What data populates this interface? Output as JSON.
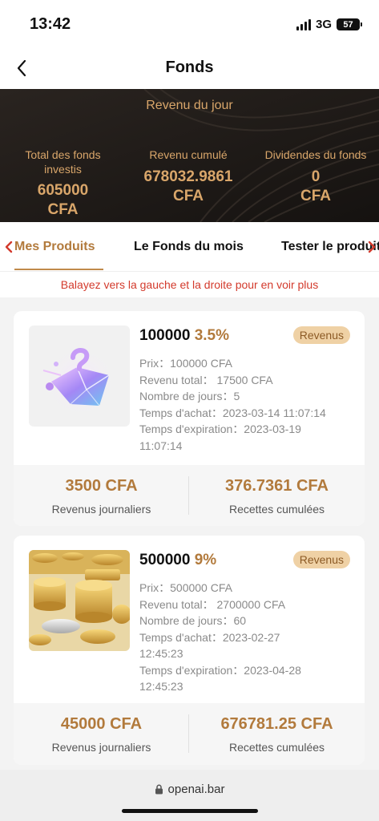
{
  "status": {
    "time": "13:42",
    "network": "3G",
    "battery": "57"
  },
  "nav": {
    "title": "Fonds"
  },
  "banner": {
    "title": "Revenu du jour",
    "stats": [
      {
        "label_line1": "Total des fonds",
        "label_line2": "investis",
        "value_line1": "605000",
        "value_line2": "CFA"
      },
      {
        "label_line1": "Revenu cumulé",
        "label_line2": "",
        "value_line1": "678032.9861",
        "value_line2": "CFA"
      },
      {
        "label_line1": "Dividendes du fonds",
        "label_line2": "",
        "value_line1": "0",
        "value_line2": "CFA"
      }
    ]
  },
  "tabs": [
    {
      "label": "Mes Produits",
      "active": true
    },
    {
      "label": "Le Fonds du mois",
      "active": false
    },
    {
      "label": "Tester le produit",
      "active": false
    }
  ],
  "hint": "Balayez vers la gauche et la droite pour en voir plus",
  "products": [
    {
      "amount": "100000",
      "rate": "3.5%",
      "badge": "Revenus",
      "price_label": "Prix：",
      "price": "100000 CFA",
      "total_label": "Revenu total：",
      "total": "17500 CFA",
      "days_label": "Nombre de jours：",
      "days": "5",
      "buy_label": "Temps d'achat：",
      "buy_time": "2023-03-14 11:07:14",
      "exp_label": "Temps d'expiration：",
      "exp_date": "2023-03-19",
      "exp_time": "11:07:14",
      "daily_value": "3500 CFA",
      "daily_label": "Revenus journaliers",
      "cumulative_value": "376.7361 CFA",
      "cumulative_label": "Recettes cumulées",
      "image_icon": "purple-crystal-icon"
    },
    {
      "amount": "500000",
      "rate": "9%",
      "badge": "Revenus",
      "price_label": "Prix：",
      "price": "500000 CFA",
      "total_label": "Revenu total：",
      "total": "2700000 CFA",
      "days_label": "Nombre de jours：",
      "days": "60",
      "buy_label": "Temps d'achat：",
      "buy_date": "2023-02-27",
      "buy_time": "12:45:23",
      "exp_label": "Temps d'expiration：",
      "exp_date": "2023-04-28",
      "exp_time": "12:45:23",
      "daily_value": "45000 CFA",
      "daily_label": "Revenus journaliers",
      "cumulative_value": "676781.25 CFA",
      "cumulative_label": "Recettes cumulées",
      "image_icon": "gold-coins-icon"
    }
  ],
  "url": {
    "domain": "openai.bar"
  },
  "colors": {
    "accent": "#b27a3c",
    "banner_bg": "#211c19",
    "hint": "#d33a2c",
    "badge_bg": "#efd1a5"
  }
}
